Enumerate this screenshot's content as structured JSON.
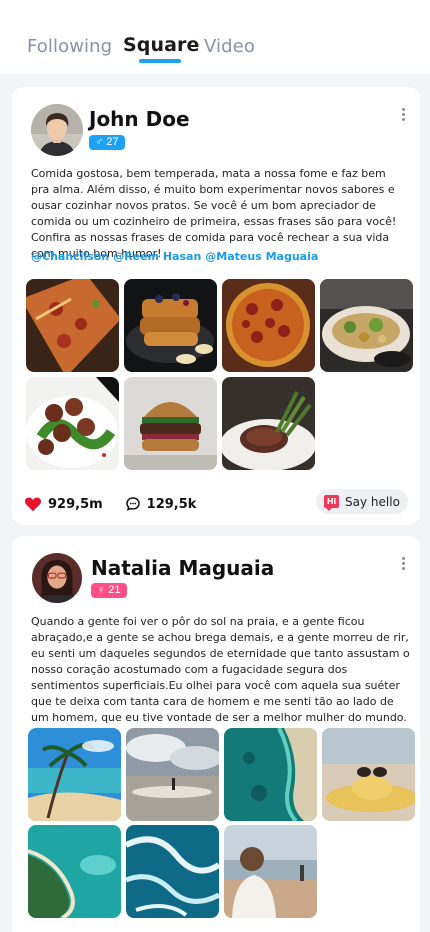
{
  "tabs": [
    {
      "label": "Following",
      "active": false
    },
    {
      "label": "Square",
      "active": true
    },
    {
      "label": "Video",
      "active": false
    }
  ],
  "colors": {
    "accent": "#1da1f2",
    "male_badge": "#1da1f2",
    "female_badge": "#ff4f86",
    "like": "#e8122e",
    "mention": "#1c9be8"
  },
  "posts": [
    {
      "author": "John Doe",
      "gender_icon": "♂",
      "age": "27",
      "text": "Comida gostosa, bem temperada, mata a nossa fome e faz bem pra alma. Além disso, é muito bom experimentar novos sabores e ousar cozinhar novos pratos. Se você é um bom apreciador de comida ou um cozinheiro de primeira, essas frases são para você! Confira as nossas frases de comida para você rechear a sua vida com muito bom humor!",
      "mentions": [
        "@Chancilson",
        "@Reem Hasan",
        "@Mateus Maguaia"
      ],
      "photos": [
        "pizza-slices",
        "french-toast",
        "pepperoni-pizza",
        "salad-bowl",
        "meatballs",
        "burger",
        "steak"
      ],
      "likes": "929,5m",
      "comments": "129,5k",
      "say_hello": "Say hello",
      "hi_label": "Hi"
    },
    {
      "author": "Natalia Maguaia",
      "gender_icon": "♀",
      "age": "21",
      "text": "Quando a gente foi ver o pôr do sol na praia, e a gente ficou abraçado,e a gente se achou brega demais, e a gente morreu de rir, eu senti um daqueles segundos de eternidade que tanto assustam o nosso coração acostumado com a fugacidade segura dos sentimentos superficiais.Eu olhei para você com aquela sua suéter que te deixa com tanta cara de homem e me senti tão ao lado de um homem, que eu tive vontade de ser a melhor mulher do mundo.",
      "photos": [
        "palm-beach",
        "cloudy-shore",
        "aerial-coast",
        "sun-hat",
        "aerial-island",
        "waves",
        "woman-on-beach"
      ]
    }
  ]
}
